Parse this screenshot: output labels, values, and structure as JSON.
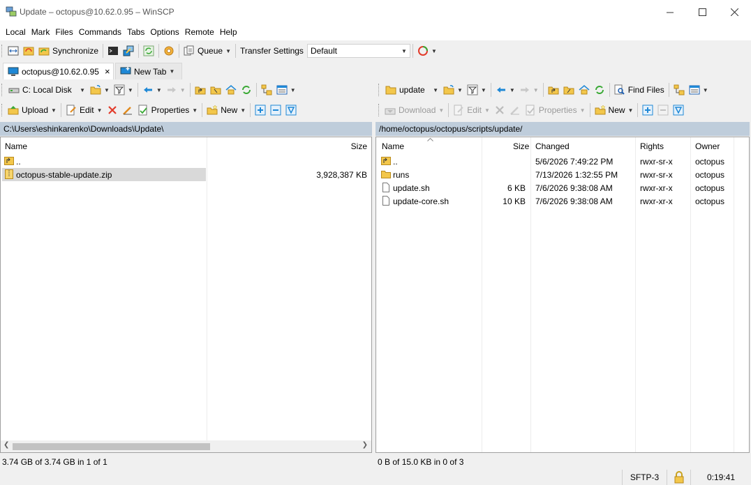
{
  "window": {
    "title": "Update – octopus@10.62.0.95 – WinSCP"
  },
  "menu": [
    "Local",
    "Mark",
    "Files",
    "Commands",
    "Tabs",
    "Options",
    "Remote",
    "Help"
  ],
  "toolbar": {
    "synchronize": "Synchronize",
    "queue": "Queue",
    "transfer_settings_label": "Transfer Settings",
    "transfer_settings_value": "Default"
  },
  "tabs": {
    "session": "octopus@10.62.0.95",
    "close": "×",
    "new_tab": "New Tab"
  },
  "local": {
    "drive": "C: Local Disk",
    "upload": "Upload",
    "edit": "Edit",
    "properties": "Properties",
    "new": "New",
    "path": "C:\\Users\\eshinkarenko\\Downloads\\Update\\",
    "columns": {
      "name": "Name",
      "size": "Size"
    },
    "rows": [
      {
        "name": "..",
        "size": ""
      },
      {
        "name": "octopus-stable-update.zip",
        "size": "3,928,387 KB"
      }
    ],
    "status": "3.74 GB of 3.74 GB in 1 of 1"
  },
  "remote": {
    "folder": "update",
    "find_files": "Find Files",
    "download": "Download",
    "edit": "Edit",
    "properties": "Properties",
    "new": "New",
    "path": "/home/octopus/octopus/scripts/update/",
    "columns": {
      "name": "Name",
      "size": "Size",
      "changed": "Changed",
      "rights": "Rights",
      "owner": "Owner"
    },
    "rows": [
      {
        "name": "..",
        "size": "",
        "changed": "5/6/2026 7:49:22 PM",
        "rights": "rwxr-sr-x",
        "owner": "octopus"
      },
      {
        "name": "runs",
        "size": "",
        "changed": "7/13/2026 1:32:55 PM",
        "rights": "rwxr-sr-x",
        "owner": "octopus"
      },
      {
        "name": "update.sh",
        "size": "6 KB",
        "changed": "7/6/2026 9:38:08 AM",
        "rights": "rwxr-xr-x",
        "owner": "octopus"
      },
      {
        "name": "update-core.sh",
        "size": "10 KB",
        "changed": "7/6/2026 9:38:08 AM",
        "rights": "rwxr-xr-x",
        "owner": "octopus"
      }
    ],
    "status": "0 B of 15.0 KB in 0 of 3"
  },
  "bottom": {
    "protocol": "SFTP-3",
    "time": "0:19:41"
  },
  "colors": {
    "path_bar": "#bfcddb",
    "folder": "#f3c74b",
    "selected_row": "#d9d9d9",
    "blue_icon": "#1e88d6",
    "green_icon": "#3aa935",
    "red_icon": "#e23b2a"
  }
}
